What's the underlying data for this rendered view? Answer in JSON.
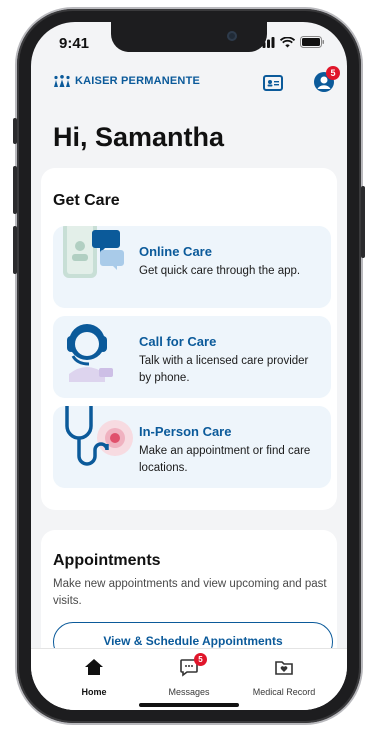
{
  "status": {
    "time": "9:41"
  },
  "header": {
    "brand": "KAISER PERMANENTE",
    "notifications_count": "5"
  },
  "greeting": "Hi, Samantha",
  "get_care": {
    "title": "Get Care",
    "options": [
      {
        "title": "Online Care",
        "description": "Get quick care through the app."
      },
      {
        "title": "Call for Care",
        "description": "Talk with a licensed care provider by phone."
      },
      {
        "title": "In-Person Care",
        "description": "Make an appointment or find care locations."
      }
    ]
  },
  "appointments": {
    "title": "Appointments",
    "description": "Make new appointments and view upcoming and past visits.",
    "button_label": "View & Schedule Appointments"
  },
  "tabbar": {
    "items": [
      {
        "label": "Home",
        "icon": "home-icon"
      },
      {
        "label": "Messages",
        "icon": "messages-icon",
        "badge": "5"
      },
      {
        "label": "Medical Record",
        "icon": "medical-record-icon"
      }
    ]
  },
  "colors": {
    "brand": "#0b5a9a",
    "badge": "#e0162b",
    "option_bg": "#eef5fb",
    "screen_bg": "#f3f4f6"
  }
}
